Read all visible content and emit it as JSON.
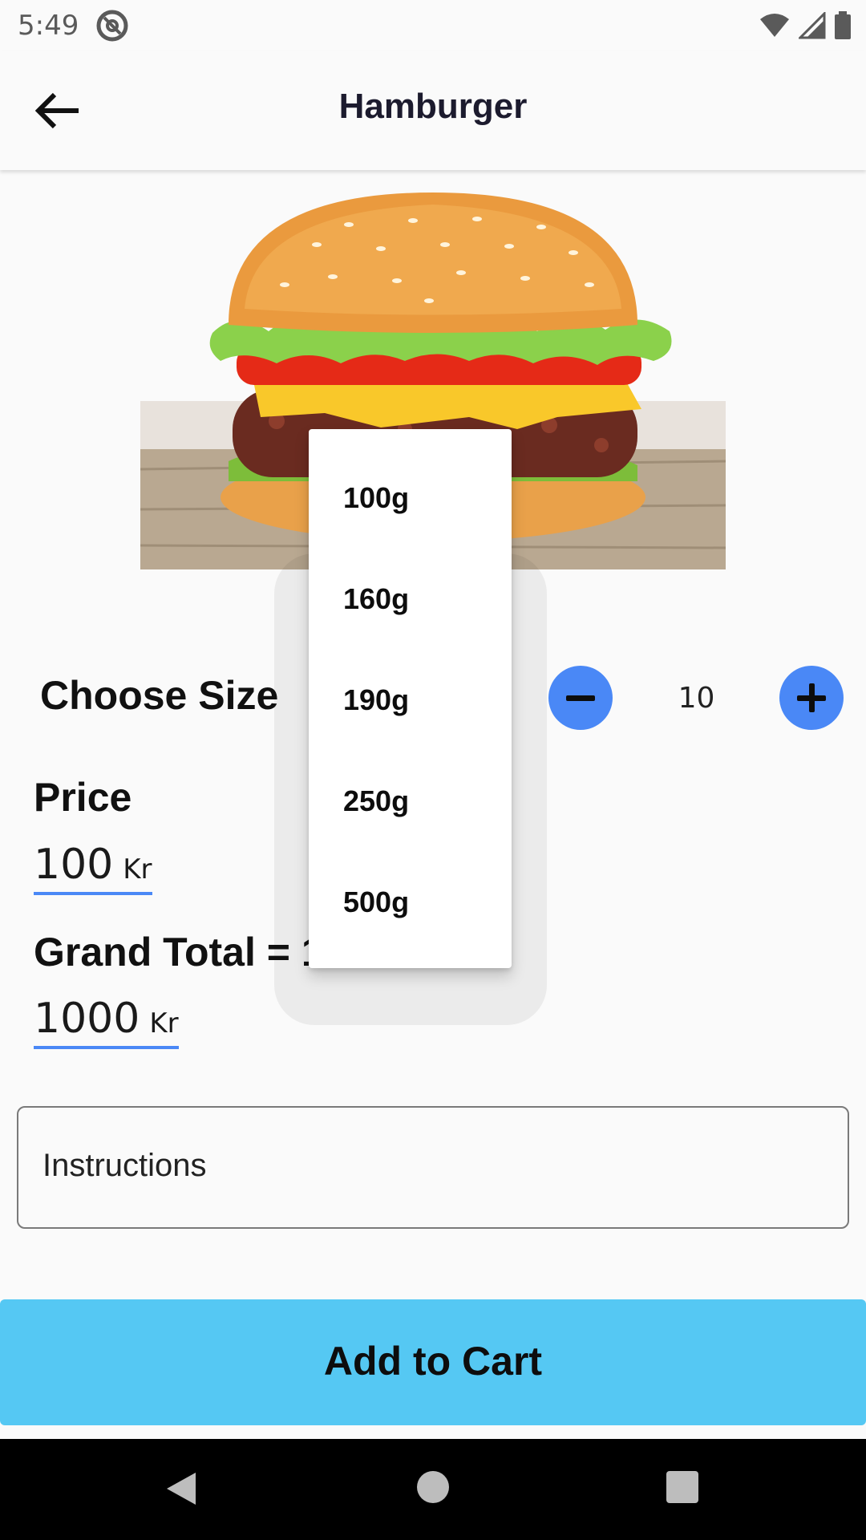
{
  "status_bar": {
    "time": "5:49",
    "icons": [
      "at-sign-icon",
      "wifi-icon",
      "signal-icon",
      "battery-icon"
    ]
  },
  "app_bar": {
    "title": "Hamburger",
    "back_icon": "arrow-left-icon"
  },
  "product": {
    "image": "hamburger-photo"
  },
  "size": {
    "label": "Choose Size",
    "quantity": "10",
    "decrease_icon": "minus-icon",
    "increase_icon": "plus-icon"
  },
  "price": {
    "label": "Price",
    "value": "100",
    "unit": "Kr"
  },
  "grand_total": {
    "label": "Grand Total = 1",
    "value": "1000",
    "unit": "Kr"
  },
  "instructions": {
    "placeholder": "Instructions"
  },
  "cart": {
    "label": "Add to Cart"
  },
  "dropdown": {
    "options": [
      "100g",
      "160g",
      "190g",
      "250g",
      "500g"
    ]
  },
  "nav_bar": {
    "icons": [
      "back-triangle-icon",
      "home-circle-icon",
      "recents-square-icon"
    ]
  },
  "colors": {
    "accent_blue": "#4a88f6",
    "cart_button": "#55c8f3",
    "background": "#fafafa"
  }
}
